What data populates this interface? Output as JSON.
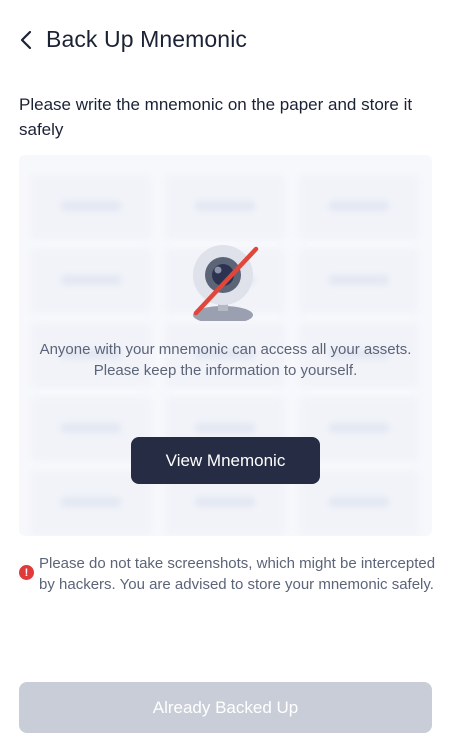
{
  "header": {
    "title": "Back Up Mnemonic",
    "back_icon": "chevron-left-icon"
  },
  "instruction": "Please write the mnemonic on the paper and store it safely",
  "card": {
    "icon": "camera-off-icon",
    "warning": "Anyone with your mnemonic can access all your assets. Please keep the information to yourself.",
    "view_button": "View Mnemonic"
  },
  "notice": {
    "icon": "alert-icon",
    "text": "Please do not take screenshots, which might be intercepted by hackers. You are advised to store your mnemonic safely."
  },
  "footer": {
    "backed_up_button": "Already Backed Up"
  },
  "colors": {
    "primary_dark": "#262c44",
    "disabled": "#c8cdd8",
    "alert": "#e03b3b",
    "strike": "#e0473a"
  }
}
